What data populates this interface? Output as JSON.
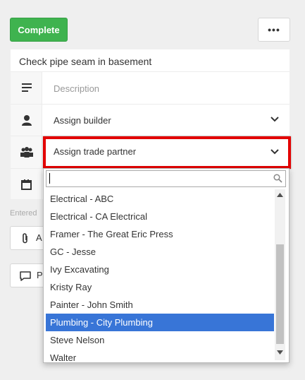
{
  "toolbar": {
    "complete_label": "Complete",
    "more_label": "•••"
  },
  "task": {
    "title": "Check pipe seam in basement",
    "description_placeholder": "Description",
    "assign_builder": "Assign builder",
    "assign_trade_partner": "Assign trade partner"
  },
  "entered_label": "Entered",
  "attach_label": "A",
  "comment_label": "P",
  "dropdown": {
    "search_value": "",
    "options": [
      "Electrical - ABC",
      "Electrical - CA Electrical",
      "Framer - The Great Eric Press",
      "GC - Jesse",
      "Ivy Excavating",
      "Kristy Ray",
      "Painter - John Smith",
      "Plumbing - City Plumbing",
      "Steve Nelson",
      "Walter"
    ],
    "selected": "Plumbing - City Plumbing"
  },
  "colors": {
    "accent": "#3fb34f",
    "highlight": "#e30000",
    "selection": "#3875d7"
  }
}
